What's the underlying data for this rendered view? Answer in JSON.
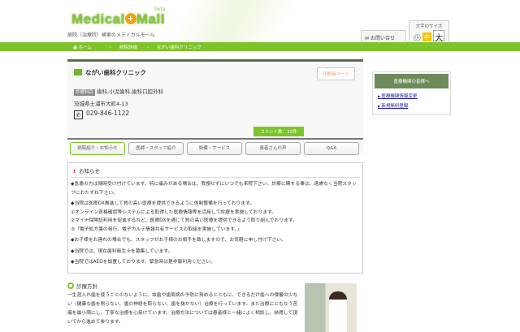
{
  "header": {
    "logo_left": "Medical",
    "logo_plus": "+",
    "logo_right": "Mall",
    "beta": "beta",
    "tagline": "病院（治療院）検索のメディカルモール",
    "contact": "お問い合せ",
    "font_size_label": "文字のサイズ",
    "font_sizes": [
      "小",
      "中",
      "大"
    ]
  },
  "breadcrumb": [
    "ホーム",
    "病院詳細",
    "ながい歯科クリニック"
  ],
  "clinic": {
    "name": "ながい歯科クリニック",
    "print": "印刷用ページ",
    "dept_tag": "診療科目",
    "depts": "歯科,小児歯科,歯科口腔外科",
    "address": "茨城県土浦市大町4-13",
    "phone": "029-846-1122"
  },
  "comment_bubble": "コメント数：33件",
  "tabs": [
    "病院紹介・お知らせ",
    "医師・スタッフ紹介",
    "設備・サービス",
    "患者さんの声",
    "Q&A"
  ],
  "news": {
    "title": "お知らせ",
    "items": [
      "◆急患の方は随時受け付けています。特に痛みがある場合は、我慢せずにいつでも来院下さい。診療に関する事は、遠慮なく当院スタッフにおたずね下さい。",
      "◆当院は医療DX推進して質の高い医療を提供できるように体制整備を行っております。",
      "①オンライン資格確認等システムによる取得した医療情報等を活用して診療を実施しております。",
      "②マイナ保険証利用を促進するなど、医療DXを通じて質の高い医療を提供できるよう取り組んでおります。",
      "③「電子処方箋の発行、電子カルテ情報共有サービスの取組を実施しています。」",
      "◆お子様をお連れの場合でも、スタッフがお子様のお相手を致しますので、お気軽に申し付け下さい。",
      "◆当院では、現在歯科衛生士を募集しています。",
      "◆当院ではAEDを設置しております。緊急時は是非御利用ください。"
    ]
  },
  "policy": {
    "title": "診療方針",
    "text": "一生涯入れ歯を使うことのないように、虫歯や歯周病の予防に努めるとともに、できるだけ歯への侵襲の少ない（健康な歯を削らない、歯の神経を取らない、歯を抜かない）治療を行っています。また治療にともなう苦痛を最小限にし、丁寧な治療を心掛けています。治療方法については患者様と一緒によく相談し、納得して頂いてから進めて参ります。"
  },
  "sidebar": {
    "header": "医療機関の皆様へ",
    "links": [
      "医療機関情報変更",
      "新規無料登録"
    ]
  }
}
